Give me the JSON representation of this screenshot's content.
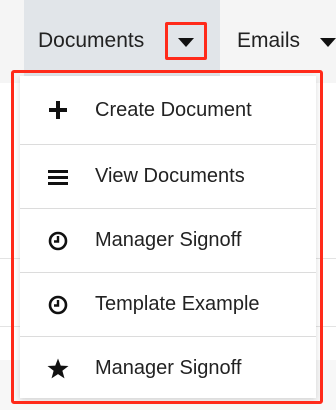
{
  "nav": {
    "tabs": [
      {
        "label": "Documents",
        "icon": "chevron-down-icon",
        "active": true
      },
      {
        "label": "Emails",
        "icon": "chevron-down-icon",
        "active": false
      }
    ]
  },
  "menu": {
    "items": [
      {
        "label": "Create Document",
        "icon": "plus-icon"
      },
      {
        "label": "View Documents",
        "icon": "list-icon"
      },
      {
        "label": "Manager Signoff",
        "icon": "clock-icon"
      },
      {
        "label": "Template Example",
        "icon": "clock-icon"
      },
      {
        "label": "Manager Signoff",
        "icon": "star-icon"
      }
    ]
  },
  "colors": {
    "highlight": "#ff2a1a",
    "active_tab": "#e1e5e9",
    "text": "#222222"
  }
}
